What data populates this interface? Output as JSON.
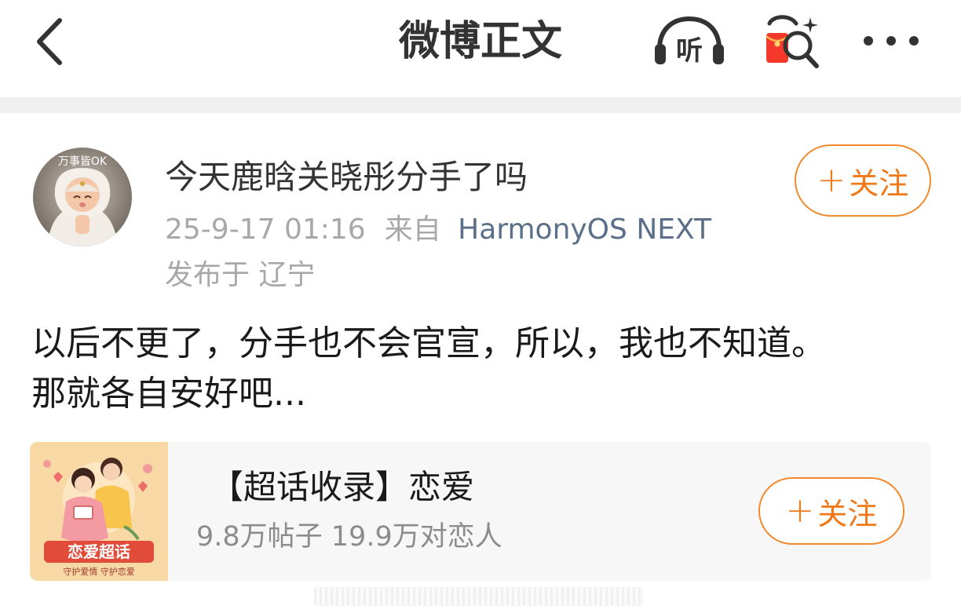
{
  "header": {
    "title": "微博正文",
    "listen_glyph": "听"
  },
  "post": {
    "author": "今天鹿晗关晓彤分手了吗",
    "avatar_caption": "万事皆OK",
    "timestamp": "25-9-17 01:16",
    "source_label": "来自",
    "source": "HarmonyOS NEXT",
    "location": "发布于 辽宁",
    "follow_label": "关注",
    "content_line1": "以后不更了，分手也不会官宣，所以，我也不知道。",
    "content_line2": "那就各自安好吧..."
  },
  "topic_card": {
    "title": "【超话收录】恋爱",
    "stats": "9.8万帖子 19.9万对恋人",
    "follow_label": "关注",
    "thumb_caption": "恋爱超话",
    "thumb_subcaption": "守护爱情 守护恋爱"
  },
  "colors": {
    "accent_orange": "#f07a1a",
    "source_link": "#5b6f88",
    "muted_text": "#a8a8a8",
    "card_bg": "#f7f7f7",
    "divider": "#f0f0f0"
  },
  "icons": [
    "back-chevron-icon",
    "listen-headphones-icon",
    "red-envelope-search-icon",
    "more-dots-icon",
    "plus-icon"
  ]
}
